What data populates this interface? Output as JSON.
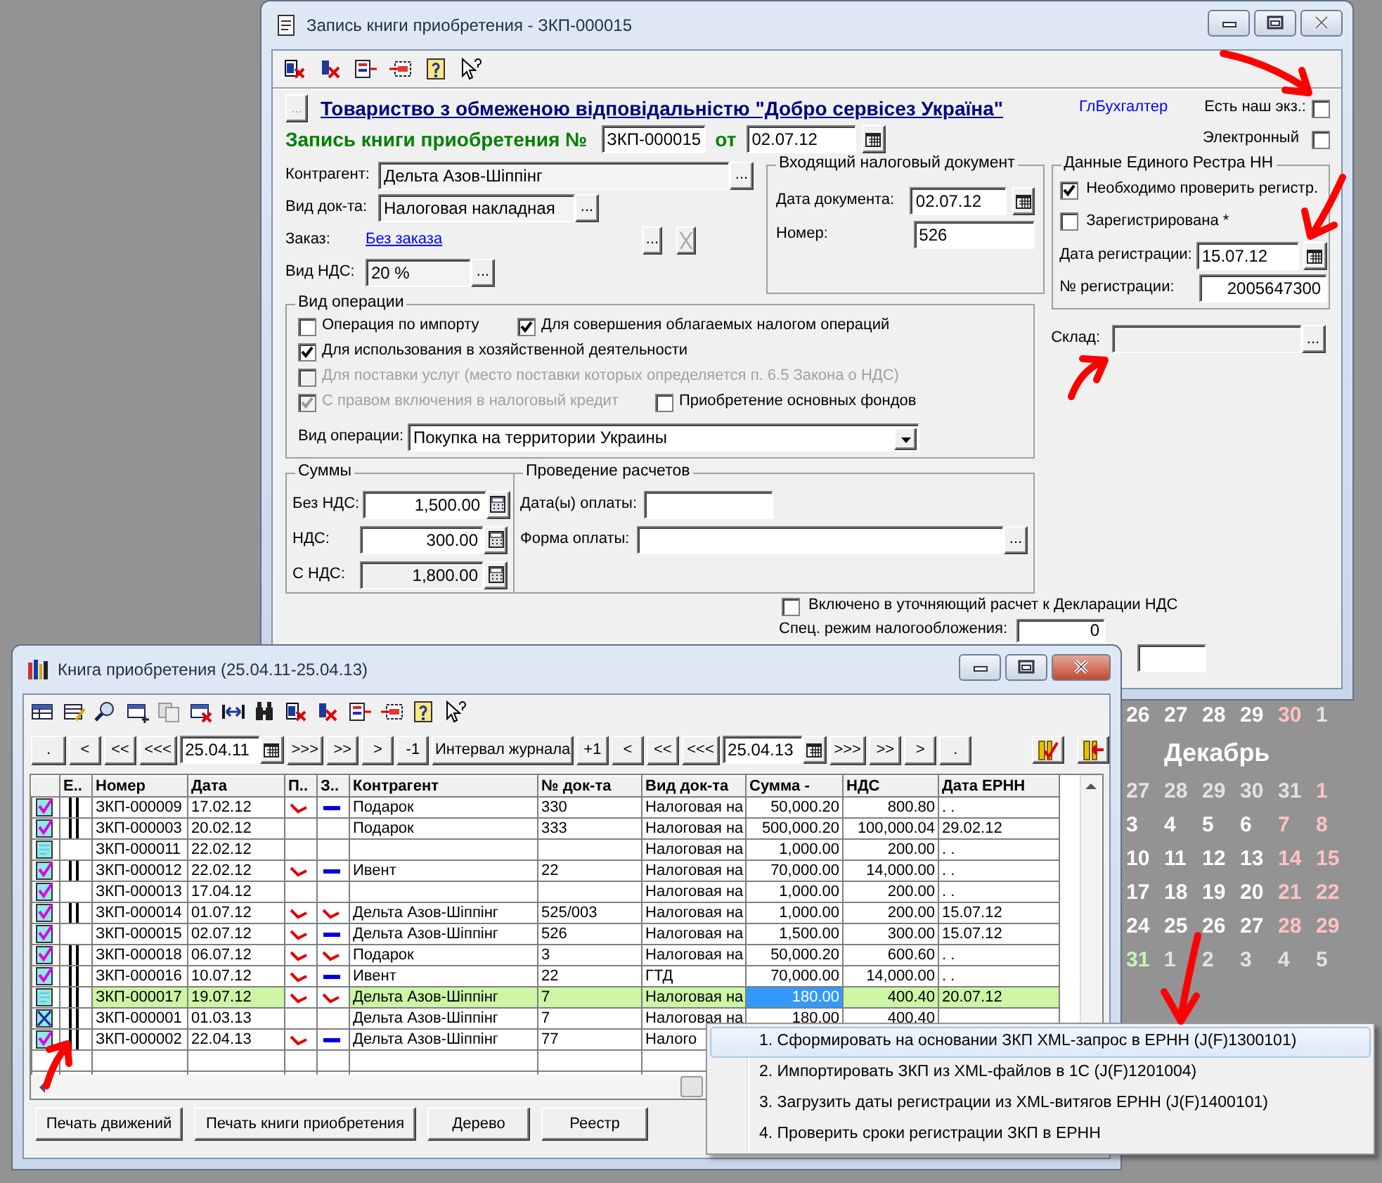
{
  "main_window": {
    "title": "Запись книги приобретения - ЗКП-000015",
    "company": {
      "button": "...",
      "name": "Товариство з обмеженою відповідальністю \"Добро сервісез Україна\""
    },
    "role_link": "ГлБухгалтер",
    "flags": [
      {
        "label": "Есть наш экз.:",
        "checked": false
      },
      {
        "label": "Электронный",
        "checked": false
      }
    ],
    "heading": "Запись книги приобретения №",
    "number": "ЗКП-000015",
    "date_label": "от",
    "date": "02.07.12",
    "fields": [
      {
        "kind": "lookup",
        "label": "Контрагент:",
        "value": "Дельта Азов-Шіппінг",
        "button": "..."
      },
      {
        "kind": "lookup",
        "label": "Вид док-та:",
        "value": "Налоговая накладная",
        "button": "..."
      },
      {
        "kind": "link",
        "label": "Заказ:",
        "value": "Без заказа",
        "button": "..."
      },
      {
        "kind": "lookup",
        "label": "Вид НДС:",
        "value": "20 %",
        "button": "..."
      }
    ],
    "incoming": {
      "title": "Входящий налоговый документ",
      "date_label": "Дата документа:",
      "date": "02.07.12",
      "number_label": "Номер:",
      "number": "526"
    },
    "registry": {
      "title": "Данные Единого Рестра НН",
      "checks": [
        {
          "label": "Необходимо проверить регистр.",
          "checked": true
        },
        {
          "label": "Зарегистрирована *",
          "checked": false
        }
      ],
      "date_label": "Дата регистрации:",
      "date": "15.07.12",
      "number_label": "№ регистрации:",
      "number": "2005647300"
    },
    "warehouse": {
      "label": "Склад:",
      "disabled": true,
      "button": "..."
    },
    "operation": {
      "title": "Вид операции",
      "check_rows": [
        [
          {
            "label": "Операция по импорту",
            "checked": false,
            "disabled": false
          },
          {
            "label": "Для совершения облагаемых налогом операций",
            "checked": true,
            "disabled": false
          }
        ],
        [
          {
            "label": "Для использования в хозяйственной деятельности",
            "checked": true,
            "disabled": false
          }
        ],
        [
          {
            "label": "Для поставки услуг (место поставки которых определяется п. 6.5 Закона о НДС)",
            "checked": false,
            "disabled": true
          }
        ],
        [
          {
            "label": "С правом включения в налоговый кредит",
            "checked": true,
            "disabled": true
          },
          {
            "label": "Приобретение основных фондов",
            "checked": false,
            "disabled": false
          }
        ]
      ],
      "type_label": "Вид операции:",
      "type": "Покупка на территории Украины"
    },
    "sums": {
      "title": "Суммы",
      "rows": [
        {
          "label": "Без НДС:",
          "value": "1,500.00",
          "disabled": false
        },
        {
          "label": "НДС:",
          "value": "300.00",
          "disabled": false
        },
        {
          "label": "С НДС:",
          "value": "1,800.00",
          "disabled": true
        }
      ]
    },
    "payments": {
      "title": "Проведение расчетов",
      "date_label": "Дата(ы) оплаты:",
      "form_label": "Форма оплаты:",
      "form_button": "..."
    },
    "refined": {
      "label": "Включено в уточняющий расчет к Декларации НДС",
      "checked": false
    },
    "special_label": "Спец. режим налогообложения:",
    "special_value": "0"
  },
  "book_window": {
    "title": "Книга приобретения (25.04.11-25.04.13)",
    "nav_left": [
      ".",
      "<",
      "<<",
      "<<<"
    ],
    "date_from": "25.04.11",
    "nav_mid": [
      ">>>",
      ">>",
      ">",
      "-1",
      "Интервал журнала",
      "+1",
      "<",
      "<<",
      "<<<"
    ],
    "date_to": "25.04.13",
    "nav_right": [
      ">>>",
      ">>",
      ">",
      "."
    ],
    "columns": [
      "Е..",
      "Номер",
      "Дата",
      "П..",
      "З..",
      "Контрагент",
      "№ док-та",
      "Вид док-та",
      "Сумма -",
      "НДС",
      "Дата ЕРНН"
    ],
    "rows": [
      {
        "status": {
          "kind": "posted"
        },
        "e_mark": true,
        "number": "ЗКП-000009",
        "date": "17.02.12",
        "p_mark": {
          "kind": "check"
        },
        "z_mark": {
          "kind": "dash"
        },
        "contractor": "Подарок",
        "doc_no": "330",
        "doc_type": "Налоговая на",
        "sum": "50,000.20",
        "vat": "800.80",
        "ernn_date": ". .",
        "selected": false
      },
      {
        "status": {
          "kind": "posted"
        },
        "e_mark": true,
        "number": "ЗКП-000003",
        "date": "20.02.12",
        "contractor": "Подарок",
        "doc_no": "333",
        "doc_type": "Налоговая на",
        "sum": "500,000.20",
        "vat": "100,000.04",
        "ernn_date": "29.02.12",
        "selected": false
      },
      {
        "status": {
          "kind": "unposted"
        },
        "e_mark": false,
        "number": "ЗКП-000011",
        "date": "22.02.12",
        "doc_type": "Налоговая на",
        "sum": "1,000.00",
        "vat": "200.00",
        "ernn_date": ". .",
        "selected": false
      },
      {
        "status": {
          "kind": "posted"
        },
        "e_mark": true,
        "number": "ЗКП-000012",
        "date": "22.02.12",
        "p_mark": {
          "kind": "check"
        },
        "z_mark": {
          "kind": "dash"
        },
        "contractor": "Ивент",
        "doc_no": "22",
        "doc_type": "Налоговая на",
        "sum": "70,000.00",
        "vat": "14,000.00",
        "ernn_date": ". .",
        "selected": false
      },
      {
        "status": {
          "kind": "posted"
        },
        "e_mark": false,
        "number": "ЗКП-000013",
        "date": "17.04.12",
        "doc_type": "Налоговая на",
        "sum": "1,000.00",
        "vat": "200.00",
        "ernn_date": ". .",
        "selected": false
      },
      {
        "status": {
          "kind": "posted"
        },
        "e_mark": true,
        "number": "ЗКП-000014",
        "date": "01.07.12",
        "p_mark": {
          "kind": "check"
        },
        "z_mark": {
          "kind": "check"
        },
        "contractor": "Дельта Азов-Шіппінг",
        "doc_no": "525/003",
        "doc_type": "Налоговая на",
        "sum": "1,000.00",
        "vat": "200.00",
        "ernn_date": "15.07.12",
        "selected": false
      },
      {
        "status": {
          "kind": "posted"
        },
        "e_mark": false,
        "number": "ЗКП-000015",
        "date": "02.07.12",
        "p_mark": {
          "kind": "check"
        },
        "z_mark": {
          "kind": "dash"
        },
        "contractor": "Дельта Азов-Шіппінг",
        "doc_no": "526",
        "doc_type": "Налоговая на",
        "sum": "1,500.00",
        "vat": "300.00",
        "ernn_date": "15.07.12",
        "selected": false
      },
      {
        "status": {
          "kind": "posted"
        },
        "e_mark": true,
        "number": "ЗКП-000018",
        "date": "06.07.12",
        "p_mark": {
          "kind": "check"
        },
        "z_mark": {
          "kind": "check"
        },
        "contractor": "Подарок",
        "doc_no": "3",
        "doc_type": "Налоговая на",
        "sum": "50,000.20",
        "vat": "600.60",
        "ernn_date": ". .",
        "selected": false
      },
      {
        "status": {
          "kind": "posted"
        },
        "e_mark": true,
        "number": "ЗКП-000016",
        "date": "10.07.12",
        "p_mark": {
          "kind": "check"
        },
        "z_mark": {
          "kind": "dash"
        },
        "contractor": "Ивент",
        "doc_no": "22",
        "doc_type": "ГТД",
        "sum": "70,000.00",
        "vat": "14,000.00",
        "ernn_date": ". .",
        "selected": false
      },
      {
        "status": {
          "kind": "unposted"
        },
        "e_mark": true,
        "number": "ЗКП-000017",
        "date": "19.07.12",
        "p_mark": {
          "kind": "check"
        },
        "z_mark": {
          "kind": "check"
        },
        "contractor": "Дельта Азов-Шіппінг",
        "doc_no": "7",
        "doc_type": "Налоговая на",
        "sum": "180.00",
        "vat": "400.40",
        "ernn_date": "20.07.12",
        "selected": true,
        "focus": {
          "kind": "sum"
        }
      },
      {
        "status": {
          "kind": "deleted"
        },
        "e_mark": true,
        "number": "ЗКП-000001",
        "date": "01.03.13",
        "contractor": "Дельта Азов-Шіппінг",
        "doc_no": "7",
        "doc_type": "Налоговая на",
        "sum": "180.00",
        "vat": "400.40",
        "selected": false
      },
      {
        "status": {
          "kind": "posted"
        },
        "e_mark": true,
        "number": "ЗКП-000002",
        "date": "22.04.13",
        "p_mark": {
          "kind": "check"
        },
        "z_mark": {
          "kind": "dash"
        },
        "contractor": "Дельта Азов-Шіппінг",
        "doc_no": "77",
        "doc_type": "Налого",
        "selected": false
      }
    ],
    "buttons": [
      "Печать движений",
      "Печать книги приобретения",
      "Дерево",
      "Реестр"
    ]
  },
  "context_menu": [
    {
      "label": "1. Сформировать на основании ЗКП XML-запрос в ЕРНН (J(F)1300101)",
      "selected": true
    },
    {
      "label": "2. Импортировать ЗКП из XML-файлов в 1С (J(F)1201004)",
      "selected": false
    },
    {
      "label": "3. Загрузить даты регистрации из XML-витягов ЕРНН (J(F)1400101)",
      "selected": false
    },
    {
      "label": "4. Проверить сроки регистрации ЗКП в ЕРНН",
      "selected": false
    }
  ],
  "calendar": {
    "month": "Декабрь",
    "weeks": [
      [
        {
          "day": "26",
          "kind": "day"
        },
        {
          "day": "27",
          "kind": "day"
        },
        {
          "day": "28",
          "kind": "day"
        },
        {
          "day": "29",
          "kind": "day"
        },
        {
          "day": "30",
          "kind": "weekend"
        },
        {
          "day": "1",
          "kind": "other"
        }
      ]
    ],
    "month_weeks": [
      [
        {
          "day": "27",
          "kind": "other"
        },
        {
          "day": "28",
          "kind": "other"
        },
        {
          "day": "29",
          "kind": "other"
        },
        {
          "day": "30",
          "kind": "other"
        },
        {
          "day": "31",
          "kind": "other"
        },
        {
          "day": "1",
          "kind": "weekend"
        }
      ],
      [
        {
          "day": "3",
          "kind": "day"
        },
        {
          "day": "4",
          "kind": "day"
        },
        {
          "day": "5",
          "kind": "day"
        },
        {
          "day": "6",
          "kind": "day"
        },
        {
          "day": "7",
          "kind": "weekend"
        },
        {
          "day": "8",
          "kind": "weekend"
        }
      ],
      [
        {
          "day": "10",
          "kind": "day"
        },
        {
          "day": "11",
          "kind": "day"
        },
        {
          "day": "12",
          "kind": "day"
        },
        {
          "day": "13",
          "kind": "day"
        },
        {
          "day": "14",
          "kind": "weekend"
        },
        {
          "day": "15",
          "kind": "weekend"
        }
      ],
      [
        {
          "day": "17",
          "kind": "day"
        },
        {
          "day": "18",
          "kind": "day"
        },
        {
          "day": "19",
          "kind": "day"
        },
        {
          "day": "20",
          "kind": "day"
        },
        {
          "day": "21",
          "kind": "weekend"
        },
        {
          "day": "22",
          "kind": "weekend"
        }
      ],
      [
        {
          "day": "24",
          "kind": "day"
        },
        {
          "day": "25",
          "kind": "day"
        },
        {
          "day": "26",
          "kind": "day"
        },
        {
          "day": "27",
          "kind": "day"
        },
        {
          "day": "28",
          "kind": "weekend"
        },
        {
          "day": "29",
          "kind": "weekend"
        }
      ],
      [
        {
          "day": "31",
          "kind": "today"
        },
        {
          "day": "1",
          "kind": "other"
        },
        {
          "day": "2",
          "kind": "other"
        },
        {
          "day": "3",
          "kind": "other"
        },
        {
          "day": "4",
          "kind": "other"
        },
        {
          "day": "5",
          "kind": "other"
        }
      ]
    ]
  },
  "annotations": [
    {
      "kind": "arrow"
    },
    {
      "kind": "arrow"
    },
    {
      "kind": "arrow"
    },
    {
      "kind": "arrow"
    },
    {
      "kind": "arrow"
    }
  ]
}
